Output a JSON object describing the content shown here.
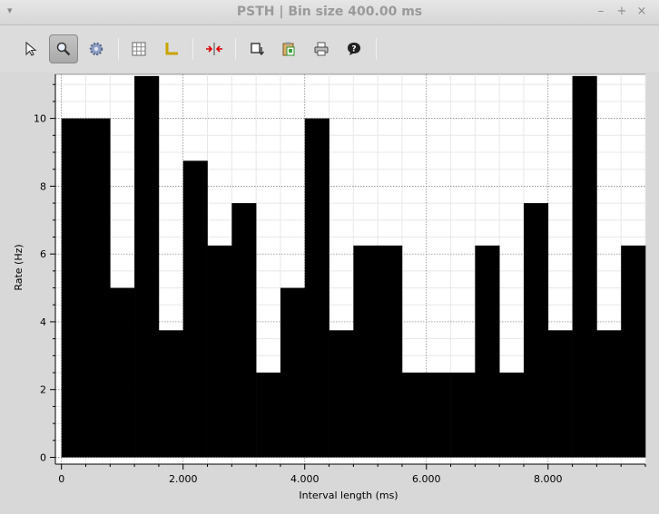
{
  "window": {
    "title": "PSTH | Bin size 400.00 ms",
    "menu_glyph": "▾",
    "min_glyph": "–",
    "max_glyph": "+",
    "close_glyph": "×"
  },
  "toolbar": {
    "tools": [
      {
        "name": "select-arrow-icon"
      },
      {
        "name": "zoom-icon",
        "active": true
      },
      {
        "name": "settings-gear-icon"
      },
      {
        "name": "grid-icon"
      },
      {
        "name": "axes-icon"
      },
      {
        "name": "scale-arrows-icon"
      },
      {
        "name": "export-icon"
      },
      {
        "name": "copy-clipboard-icon"
      },
      {
        "name": "print-icon"
      },
      {
        "name": "help-icon"
      }
    ]
  },
  "colors": {
    "bars": "#000000",
    "plot_background": "#ffffff",
    "frame_background": "#d8d8d8"
  },
  "chart_data": {
    "type": "bar",
    "xlabel": "Interval length (ms)",
    "ylabel": "Rate (Hz)",
    "xlim": [
      -100,
      9600
    ],
    "ylim": [
      -0.2,
      11.3
    ],
    "x_ticks": [
      0,
      2000,
      4000,
      6000,
      8000
    ],
    "x_tick_labels": [
      "0",
      "2.000",
      "4.000",
      "6.000",
      "8.000"
    ],
    "y_ticks": [
      0,
      2,
      4,
      6,
      8,
      10
    ],
    "y_tick_labels": [
      "0",
      "2",
      "4",
      "6",
      "8",
      "10"
    ],
    "grid": true,
    "bin_width": 400,
    "bin_starts": [
      0,
      400,
      800,
      1200,
      1600,
      2000,
      2400,
      2800,
      3200,
      3600,
      4000,
      4400,
      4800,
      5200,
      5600,
      6000,
      6400,
      6800,
      7200,
      7600,
      8000,
      8400,
      8800,
      9200
    ],
    "values": [
      10,
      10,
      5,
      11.25,
      3.75,
      8.75,
      6.25,
      7.5,
      2.5,
      5,
      10,
      3.75,
      6.25,
      6.25,
      2.5,
      2.5,
      2.5,
      6.25,
      2.5,
      7.5,
      3.75,
      11.25,
      3.75,
      6.25
    ]
  }
}
